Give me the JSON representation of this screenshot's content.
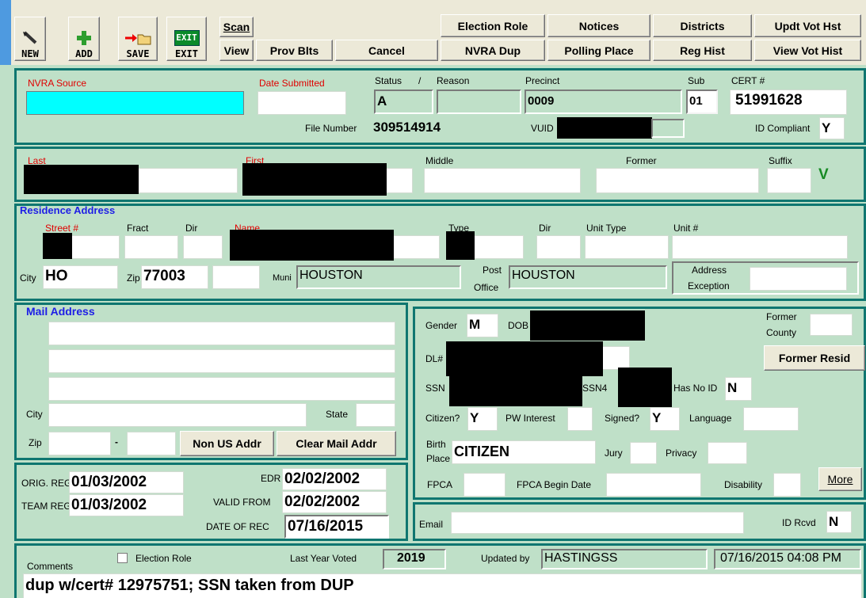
{
  "toolbar": {
    "new": "NEW",
    "add": "ADD",
    "save": "SAVE",
    "exit": "EXIT",
    "exit_icon_text": "EXIT",
    "scan": "Scan",
    "view": "View",
    "prov_blts": "Prov Blts",
    "cancel": "Cancel",
    "election_role": "Election Role",
    "nvra_dup": "NVRA Dup",
    "notices": "Notices",
    "polling_place": "Polling Place",
    "districts": "Districts",
    "reg_hist": "Reg Hist",
    "updt_vot_hst": "Updt Vot Hst",
    "view_vot_hist": "View Vot Hist"
  },
  "header": {
    "nvra_source_label": "NVRA Source",
    "nvra_source_value": "",
    "date_submitted_label": "Date Submitted",
    "date_submitted_value": "",
    "status_label": "Status",
    "slash": "/",
    "reason_label": "Reason",
    "status_value": "A",
    "reason_value": "",
    "precinct_label": "Precinct",
    "precinct_value": "0009",
    "sub_label": "Sub",
    "sub_value": "01",
    "cert_label": "CERT #",
    "cert_value": "51991628",
    "file_number_label": "File Number",
    "file_number_value": "309514914",
    "vuid_label": "VUID",
    "id_compliant_label": "ID Compliant",
    "id_compliant_value": "Y"
  },
  "name": {
    "last_label": "Last",
    "first_label": "First",
    "middle_label": "Middle",
    "former_label": "Former",
    "suffix_label": "Suffix",
    "verified_mark": "V"
  },
  "residence": {
    "section_title": "Residence Address",
    "street_label": "Street #",
    "fract_label": "Fract",
    "dir_label": "Dir",
    "name_label": "Name",
    "type_label": "Type",
    "dir2_label": "Dir",
    "unit_type_label": "Unit Type",
    "unit_label": "Unit #",
    "city_label": "City",
    "city_value": "HO",
    "zip_label": "Zip",
    "zip_value": "77003",
    "muni_label": "Muni",
    "muni_value": "HOUSTON",
    "post_label": "Post",
    "office_label": "Office",
    "post_office_value": "HOUSTON",
    "address_label": "Address",
    "exception_label": "Exception"
  },
  "mail": {
    "section_title": "Mail Address",
    "city_label": "City",
    "state_label": "State",
    "zip_label": "Zip",
    "dash": "-",
    "non_us_button": "Non US Addr",
    "clear_button": "Clear Mail Addr"
  },
  "personal": {
    "gender_label": "Gender",
    "gender_value": "M",
    "dob_label": "DOB",
    "former_label": "Former",
    "county_label": "County",
    "former_resid_button": "Former Resid",
    "dl_label": "DL#",
    "ssn_label": "SSN",
    "ssn4_label": "SSN4",
    "has_no_id_label": "Has No ID",
    "has_no_id_value": "N",
    "citizen_label": "Citizen?",
    "citizen_value": "Y",
    "pw_interest_label": "PW Interest",
    "signed_label": "Signed?",
    "signed_value": "Y",
    "language_label": "Language",
    "birth_label": "Birth",
    "place_label": "Place",
    "birth_place_value": "CITIZEN",
    "jury_label": "Jury",
    "privacy_label": "Privacy",
    "fpca_label": "FPCA",
    "fpca_begin_label": "FPCA Begin Date",
    "disability_label": "Disability",
    "more_button": "More",
    "email_label": "Email",
    "id_rcvd_label": "ID Rcvd",
    "id_rcvd_value": "N"
  },
  "dates": {
    "orig_reg_label": "ORIG. REG",
    "orig_reg_value": "01/03/2002",
    "team_reg_label": "TEAM REG",
    "team_reg_value": "01/03/2002",
    "edr_label": "EDR",
    "edr_value": "02/02/2002",
    "valid_from_label": "VALID FROM",
    "valid_from_value": "02/02/2002",
    "date_of_rec_label": "DATE OF REC",
    "date_of_rec_value": "07/16/2015"
  },
  "footer": {
    "comments_label": "Comments",
    "election_role_label": "Election Role",
    "last_year_voted_label": "Last Year Voted",
    "last_year_voted_value": "2019",
    "updated_by_label": "Updated by",
    "updated_by_value": "HASTINGSS",
    "updated_at_value": "07/16/2015 04:08 PM",
    "comment_text": "dup w/cert# 12975751; SSN taken from DUP"
  }
}
